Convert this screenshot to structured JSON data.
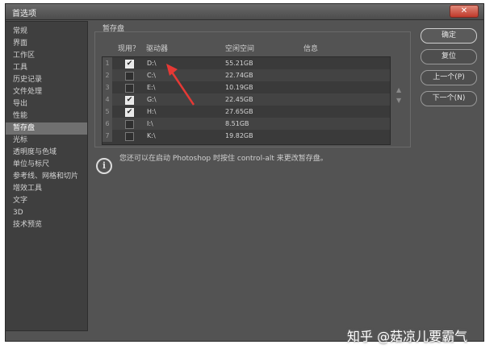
{
  "window": {
    "title": "首选项",
    "close_label": "✕"
  },
  "sidebar": {
    "items": [
      {
        "label": "常规"
      },
      {
        "label": "界面"
      },
      {
        "label": "工作区"
      },
      {
        "label": "工具"
      },
      {
        "label": "历史记录"
      },
      {
        "label": "文件处理"
      },
      {
        "label": "导出"
      },
      {
        "label": "性能"
      },
      {
        "label": "暂存盘",
        "active": true
      },
      {
        "label": "光标"
      },
      {
        "label": "透明度与色域"
      },
      {
        "label": "单位与标尺"
      },
      {
        "label": "参考线、网格和切片"
      },
      {
        "label": "增效工具"
      },
      {
        "label": "文字"
      },
      {
        "label": "3D"
      },
      {
        "label": "技术预览"
      }
    ]
  },
  "scratch": {
    "group_label": "暂存盘",
    "columns": {
      "active": "现用？",
      "drive": "驱动器",
      "free": "空闲空间",
      "info": "信息"
    },
    "rows": [
      {
        "num": "1",
        "checked": true,
        "drive": "D:\\",
        "free": "55.21GB",
        "info": ""
      },
      {
        "num": "2",
        "checked": false,
        "drive": "C:\\",
        "free": "22.74GB",
        "info": ""
      },
      {
        "num": "3",
        "checked": false,
        "drive": "E:\\",
        "free": "10.19GB",
        "info": ""
      },
      {
        "num": "4",
        "checked": true,
        "drive": "G:\\",
        "free": "22.45GB",
        "info": ""
      },
      {
        "num": "5",
        "checked": true,
        "drive": "H:\\",
        "free": "27.65GB",
        "info": ""
      },
      {
        "num": "6",
        "checked": false,
        "drive": "I:\\",
        "free": "8.51GB",
        "info": ""
      },
      {
        "num": "7",
        "checked": false,
        "drive": "K:\\",
        "free": "19.82GB",
        "info": ""
      }
    ],
    "move_up": "▲",
    "move_down": "▼",
    "info_icon": "i",
    "info_text": "您还可以在启动 Photoshop 时按住 control-alt 来更改暂存盘。"
  },
  "buttons": {
    "ok": "确定",
    "reset": "复位",
    "prev": "上一个(P)",
    "next": "下一个(N)"
  },
  "watermark": "知乎 @菇凉儿要霸气",
  "colors": {
    "dialog_bg": "#535353",
    "panel_bg": "#3f3f3f",
    "selected": "#707070",
    "annotation_arrow": "#e53935"
  }
}
